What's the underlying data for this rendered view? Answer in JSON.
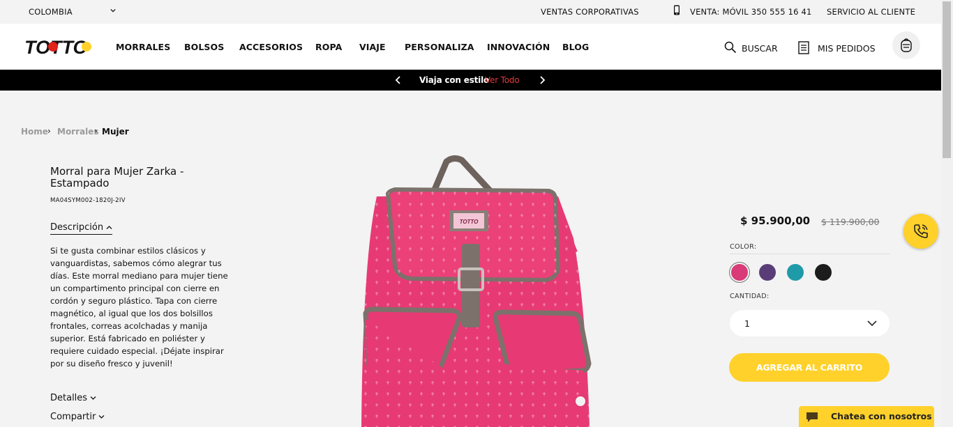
{
  "topbar": {
    "country": "COLOMBIA",
    "corporate_sales": "VENTAS CORPORATIVAS",
    "phone_sales": "VENTA: MÓVIL 350 555 16 41",
    "customer_service": "SERVICIO AL CLIENTE"
  },
  "header": {
    "brand": "TOTTO",
    "nav": [
      "MORRALES",
      "BOLSOS",
      "ACCESORIOS",
      "ROPA",
      "VIAJE",
      "PERSONALIZA",
      "INNOVACIÓN",
      "BLOG"
    ],
    "search_label": "BUSCAR",
    "orders_label": "MIS PEDIDOS"
  },
  "promo": {
    "text": "Viaja con estilo",
    "link": "Ver Todo"
  },
  "breadcrumb": {
    "items": [
      "Home",
      "Morrales",
      "Mujer"
    ]
  },
  "product": {
    "title": "Morral para Mujer Zarka - Estampado",
    "sku": "MA04SYM002-1820J-2IV",
    "description_label": "Descripción",
    "description": "Si te gusta combinar estilos clásicos y vanguardistas, sabemos cómo alegrar tus días. Este morral mediano para mujer tiene un compartimento principal con cierre en cordón y seguro plástico. Tapa con cierre magnético, al igual que los dos bolsillos frontales, correas acolchadas y manija superior. Está fabricado en poliéster y requiere cuidado especial. ¡Déjate inspirar por su diseño fresco y juvenil!",
    "details_label": "Detalles",
    "share_label": "Compartir",
    "price": "$ 95.900,00",
    "old_price": "$ 119.900,00",
    "color_label": "COLOR:",
    "colors": [
      "#d93a78",
      "#5a3d78",
      "#1f9aa8",
      "#1c1c1c"
    ],
    "quantity_label": "CANTIDAD:",
    "quantity": "1",
    "add_to_cart": "AGREGAR AL CARRITO"
  },
  "chat": {
    "label": "Chatea con nosotros"
  },
  "accent_color": "#ffd12a"
}
